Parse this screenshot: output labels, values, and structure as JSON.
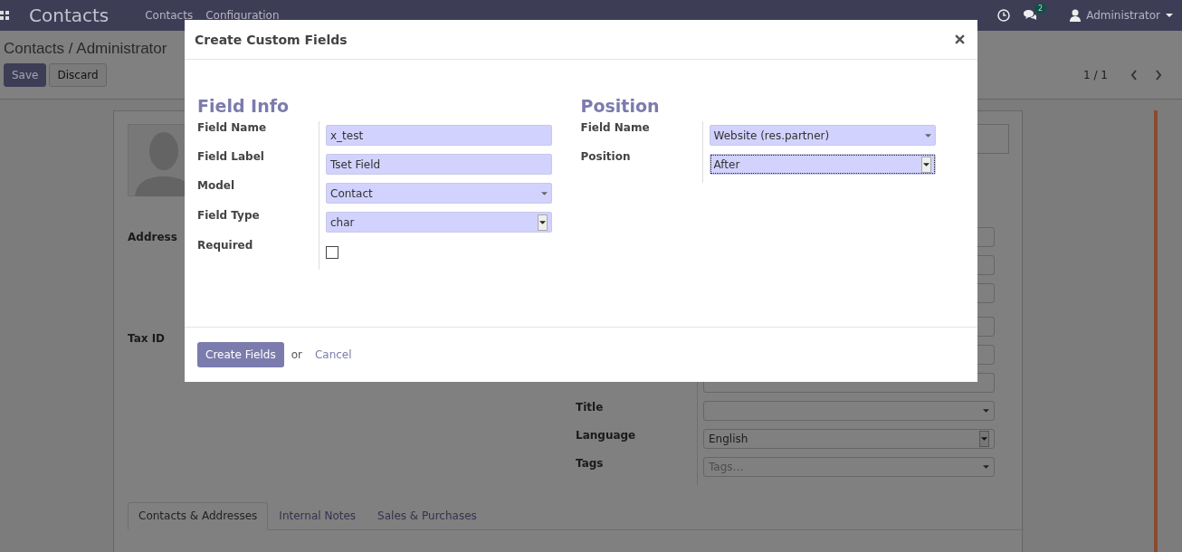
{
  "navbar": {
    "brand": "Contacts",
    "menu": [
      "Contacts",
      "Configuration"
    ],
    "messages_badge": "2",
    "user": "Administrator"
  },
  "control_panel": {
    "breadcrumb": "Contacts / Administrator",
    "buttons": [
      "Save",
      "Discard"
    ],
    "pager": "1 / 1"
  },
  "form": {
    "left_labels": [
      "Address",
      "Tax ID"
    ],
    "fields": [
      {
        "label": "Title",
        "kind": "select"
      },
      {
        "label": "Language",
        "kind": "native_select",
        "value": "English"
      },
      {
        "label": "Tags",
        "kind": "select",
        "placeholder": "Tags…"
      }
    ],
    "tabs": [
      {
        "label": "Contacts & Addresses",
        "selected": true
      },
      {
        "label": "Internal Notes",
        "selected": false
      },
      {
        "label": "Sales & Purchases",
        "selected": false
      }
    ]
  },
  "dialog": {
    "title": "Create Custom Fields",
    "sections": [
      {
        "heading": "Field Info",
        "rows": [
          {
            "label": "Field Name",
            "kind": "text",
            "value": "x_test"
          },
          {
            "label": "Field Label",
            "kind": "text",
            "value": "Tset Field"
          },
          {
            "label": "Model",
            "kind": "select",
            "value": "Contact"
          },
          {
            "label": "Field Type",
            "kind": "native_select",
            "value": "char"
          },
          {
            "label": "Required",
            "kind": "checkbox",
            "checked": false
          }
        ]
      },
      {
        "heading": "Position",
        "rows": [
          {
            "label": "Field Name",
            "kind": "select",
            "value": "Website (res.partner)"
          },
          {
            "label": "Position",
            "kind": "native_select",
            "value": "After",
            "focused": true
          }
        ]
      }
    ],
    "primary_button": "Create Fields",
    "or_text": "or",
    "cancel": "Cancel"
  }
}
